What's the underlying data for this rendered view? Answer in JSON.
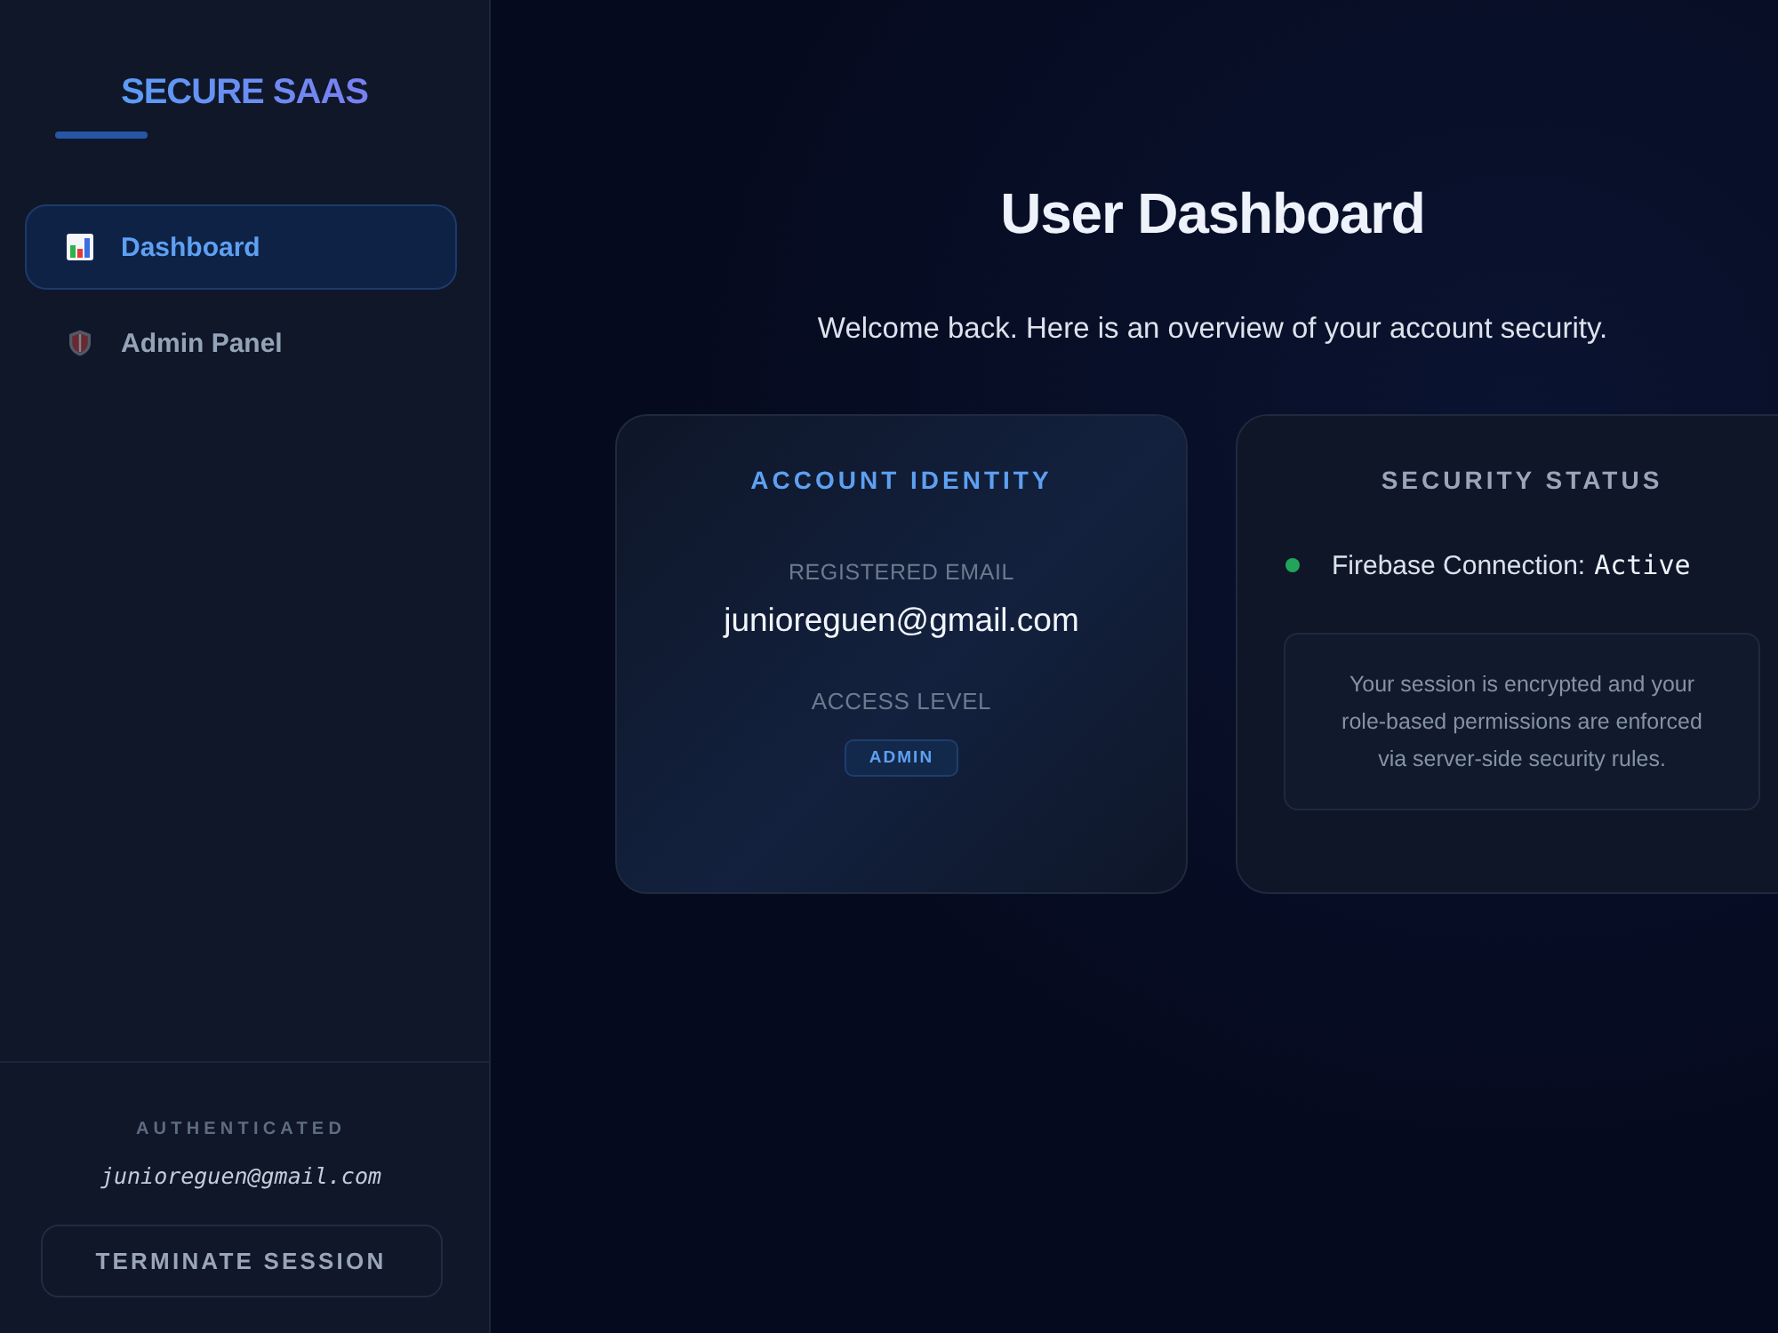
{
  "sidebar": {
    "logo": "SECURE SAAS",
    "nav": [
      {
        "label": "Dashboard",
        "selected": true
      },
      {
        "label": "Admin Panel",
        "selected": false
      }
    ],
    "footer": {
      "status_label": "AUTHENTICATED",
      "email": "junioreguen@gmail.com",
      "button": "TERMINATE SESSION"
    }
  },
  "main": {
    "title": "User Dashboard",
    "subtitle": "Welcome back. Here is an overview of your account security.",
    "identity_card": {
      "title": "ACCOUNT IDENTITY",
      "email_label": "REGISTERED EMAIL",
      "email": "junioreguen@gmail.com",
      "access_label": "ACCESS LEVEL",
      "badge": "ADMIN"
    },
    "security_card": {
      "title": "SECURITY STATUS",
      "status": {
        "label": "Firebase Connection:",
        "value": "Active",
        "color": "#22a55a"
      },
      "note": "Your session is encrypted and your role-based permissions are enforced via server-side security rules."
    }
  }
}
